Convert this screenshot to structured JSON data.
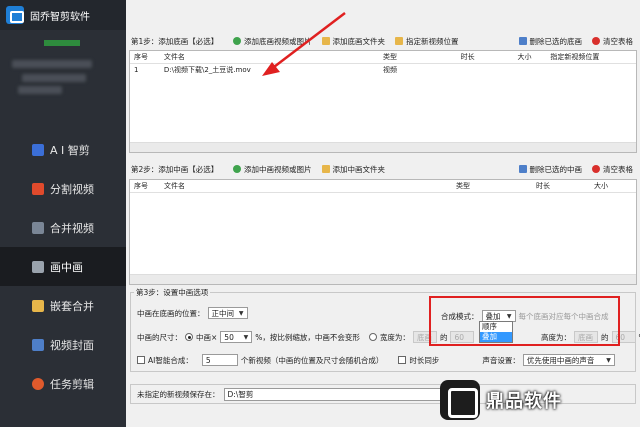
{
  "app": {
    "title": "固乔智剪软件"
  },
  "sidebar": {
    "items": [
      {
        "label": "A I 智剪",
        "icon": "ai-icon",
        "color": "#3b6fd8"
      },
      {
        "label": "分割视频",
        "icon": "split-icon",
        "color": "#e04a2c"
      },
      {
        "label": "合并视频",
        "icon": "merge-icon",
        "color": "#7a8696"
      },
      {
        "label": "画中画",
        "icon": "pip-icon",
        "color": "#9aa3ad"
      },
      {
        "label": "嵌套合并",
        "icon": "nest-icon",
        "color": "#e7b64a"
      },
      {
        "label": "视频封面",
        "icon": "cover-icon",
        "color": "#4e7fc9"
      },
      {
        "label": "任务剪辑",
        "icon": "task-icon",
        "color": "#e05a2c"
      }
    ],
    "active_index": 3
  },
  "step1": {
    "label": "第1步：添加底画【必选】",
    "add_video": "添加底画视频或图片",
    "add_folder": "添加底画文件夹",
    "set_location": "指定新视频位置",
    "delete_selected": "删除已选的底画",
    "clear_table": "清空表格",
    "columns": [
      "序号",
      "文件名",
      "类型",
      "时长",
      "大小",
      "指定新视频位置"
    ],
    "rows": [
      [
        "1",
        "D:\\视频下载\\2_土豆说.mov",
        "视频",
        "",
        "",
        ""
      ]
    ]
  },
  "step2": {
    "label": "第2步：添加中画【必选】",
    "add_video": "添加中画视频或图片",
    "add_folder": "添加中画文件夹",
    "delete_selected": "删除已选的中画",
    "clear_table": "清空表格",
    "columns": [
      "序号",
      "文件名",
      "类型",
      "时长",
      "大小"
    ]
  },
  "step3": {
    "label": "第3步：设置中画选项",
    "position_label": "中画在底画的位置：",
    "position_value": "正中间",
    "size_label": "中画的尺寸：",
    "size_mode": "中画×",
    "size_value": "50",
    "size_note": "%，按比例缩放，中画不会变形",
    "width_label": "宽度为：",
    "width_unit": "底画",
    "width_of": "的",
    "width_value": "60",
    "height_label": "高度为：",
    "height_unit": "底画",
    "height_of": "的",
    "height_value": "60",
    "percent": "%",
    "ai_label": "AI智能合成：",
    "ai_value": "5",
    "ai_note": "个新视频（中画的位置及尺寸会随机合成）",
    "duration_sync": "时长同步",
    "mode_label": "合成模式：",
    "mode_value": "叠加",
    "mode_hint": "每个底画对应每个中画合成",
    "mode_options": [
      "顺序",
      "叠加"
    ],
    "mode_selected_index": 1,
    "sound_label": "声音设置：",
    "sound_value": "优先使用中画的声音"
  },
  "save": {
    "label": "未指定的新视频保存在：",
    "value": "D:\\智剪"
  },
  "watermark": {
    "text": "鼎品软件"
  }
}
